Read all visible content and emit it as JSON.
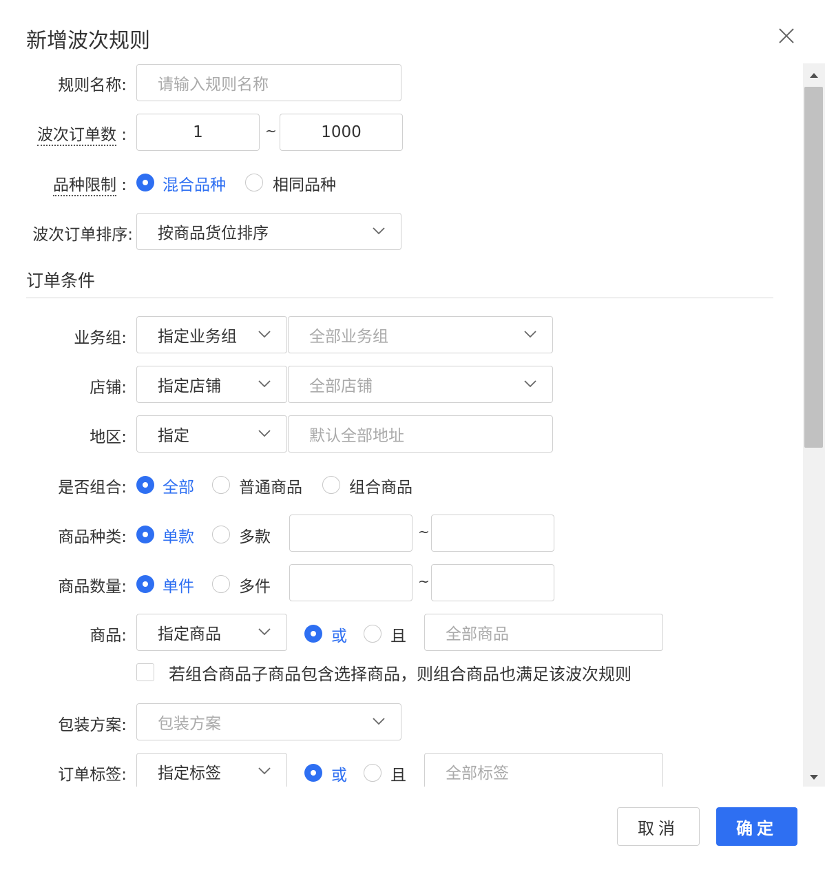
{
  "dialog": {
    "title": "新增波次规则",
    "close_icon": "close-icon"
  },
  "form": {
    "rule_name": {
      "label": "规则名称:",
      "placeholder": "请输入规则名称"
    },
    "order_count": {
      "label": "波次订单数",
      "colon": ":",
      "min": "1",
      "max": "1000",
      "separator": "~"
    },
    "variety_limit": {
      "label": "品种限制",
      "colon": ":",
      "options": [
        "混合品种",
        "相同品种"
      ],
      "selected": "混合品种"
    },
    "sort": {
      "label": "波次订单排序:",
      "value": "按商品货位排序"
    }
  },
  "order_conditions": {
    "title": "订单条件",
    "business_group": {
      "label": "业务组:",
      "mode": "指定业务组",
      "value": "全部业务组"
    },
    "store": {
      "label": "店铺:",
      "mode": "指定店铺",
      "value": "全部店铺"
    },
    "region": {
      "label": "地区:",
      "mode": "指定",
      "placeholder": "默认全部地址"
    },
    "is_combo": {
      "label": "是否组合:",
      "options": [
        "全部",
        "普通商品",
        "组合商品"
      ],
      "selected": "全部"
    },
    "sku_kind": {
      "label": "商品种类:",
      "options": [
        "单款",
        "多款"
      ],
      "selected": "单款",
      "separator": "~"
    },
    "sku_qty": {
      "label": "商品数量:",
      "options": [
        "单件",
        "多件"
      ],
      "selected": "单件",
      "separator": "~"
    },
    "product": {
      "label": "商品:",
      "mode": "指定商品",
      "logic": [
        "或",
        "且"
      ],
      "logic_selected": "或",
      "value": "全部商品"
    },
    "combo_checkbox": {
      "label": "若组合商品子商品包含选择商品，则组合商品也满足该波次规则",
      "checked": false
    },
    "packaging": {
      "label": "包装方案:",
      "placeholder": "包装方案"
    },
    "order_tag": {
      "label": "订单标签:",
      "mode": "指定标签",
      "logic": [
        "或",
        "且"
      ],
      "logic_selected": "或",
      "value": "全部标签"
    }
  },
  "footer": {
    "cancel": "取消",
    "ok": "确定"
  },
  "colors": {
    "primary": "#2e6ff2",
    "border": "#d0d0d0",
    "placeholder": "#aaaaaa"
  }
}
